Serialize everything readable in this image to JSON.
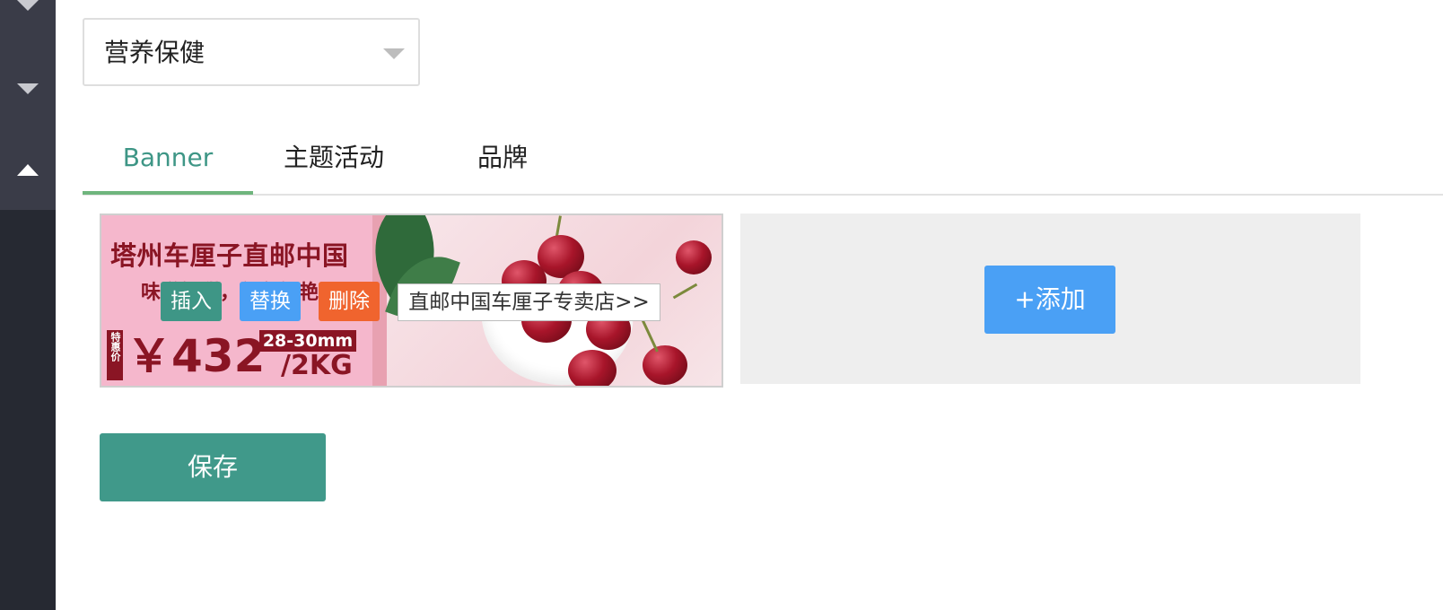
{
  "category_select": {
    "value": "营养保健"
  },
  "tabs": [
    {
      "label": "Banner",
      "active": true
    },
    {
      "label": "主题活动",
      "active": false
    },
    {
      "label": "品牌",
      "active": false
    }
  ],
  "banner": {
    "headline": "塔州车厘子直邮中国",
    "subline": "味道鲜甜，颜色鲜艳",
    "price_tag": "特惠价",
    "price": "￥432",
    "size": "28-30mm",
    "weight": "/2KG",
    "actions": {
      "insert": "插入",
      "replace": "替换",
      "delete": "删除"
    },
    "link_text": "直邮中国车厘子专卖店>>"
  },
  "add_button_label": "+添加",
  "save_label": "保存",
  "colors": {
    "sidebar_bg": "#262932",
    "sidebar_active": "#3a3c48",
    "primary_green": "#40998a",
    "tab_active_text": "#3e9686",
    "tab_underline": "#6fb57d",
    "blue": "#4aa0f5",
    "orange": "#f0642e",
    "banner_text": "#8a1524"
  }
}
